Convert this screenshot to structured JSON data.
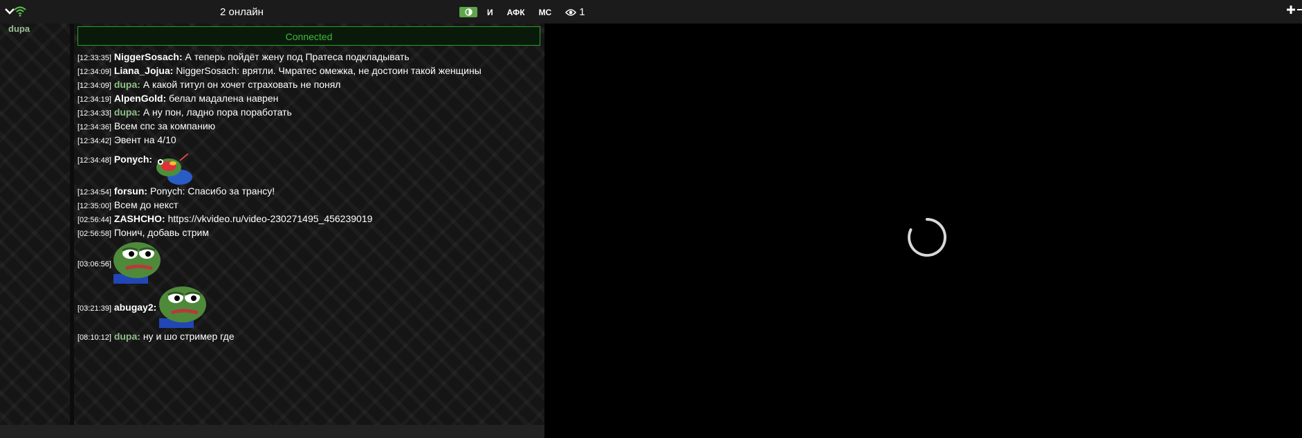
{
  "topbar": {
    "online_text": "2 онлайн",
    "btn_i": "И",
    "btn_afk": "АФК",
    "btn_ms": "МС",
    "viewer_count": "1",
    "toggle_color": "#5ea64b"
  },
  "userlist": {
    "users": [
      "dupa"
    ]
  },
  "chat": {
    "connected_text": "Connected",
    "messages": [
      {
        "time": "[12:33:35]",
        "nick": "NiggerSosach:",
        "text": "А теперь пойдёт жену под Пратеса подкладывать"
      },
      {
        "time": "[12:34:09]",
        "nick": "Liana_Jojua:",
        "text": "NiggerSosach: врятли. Чмратес омежка, не достоин такой женщины"
      },
      {
        "time": "[12:34:09]",
        "nick": "dupa:",
        "text": "А какой титул он хочет страховать не понял"
      },
      {
        "time": "[12:34:19]",
        "nick": "AlpenGold:",
        "text": "белал мадалена наврен"
      },
      {
        "time": "[12:34:33]",
        "nick": "dupa:",
        "text": "А ну пон, ладно пора поработать"
      },
      {
        "time": "[12:34:36]",
        "text": "Всем спс за компанию"
      },
      {
        "time": "[12:34:42]",
        "text": "Эвент на 4/10"
      },
      {
        "time": "[12:34:48]",
        "nick": "Ponych:",
        "emote": "pepe-rainbow-emote"
      },
      {
        "time": "[12:34:54]",
        "nick": "forsun:",
        "text": "Ponych: Спасибо за трансу!"
      },
      {
        "time": "[12:35:00]",
        "text": "Всем до некст"
      },
      {
        "time": "[02:56:44]",
        "nick": "ZASHCHO:",
        "text": "https://vkvideo.ru/video-230271495_456239019"
      },
      {
        "time": "[02:56:58]",
        "text": "Понич, добавь стрим"
      },
      {
        "time": "[03:06:56]",
        "emote": "pepe-emote"
      },
      {
        "time": "[03:21:39]",
        "nick": "abugay2:",
        "emote": "pepe-emote"
      },
      {
        "time": "[08:10:12]",
        "nick": "dupa:",
        "text": "ну и шо стример где"
      }
    ]
  },
  "colors": {
    "self_nick": "#8fbf86",
    "connected_green": "#3fb83f"
  }
}
